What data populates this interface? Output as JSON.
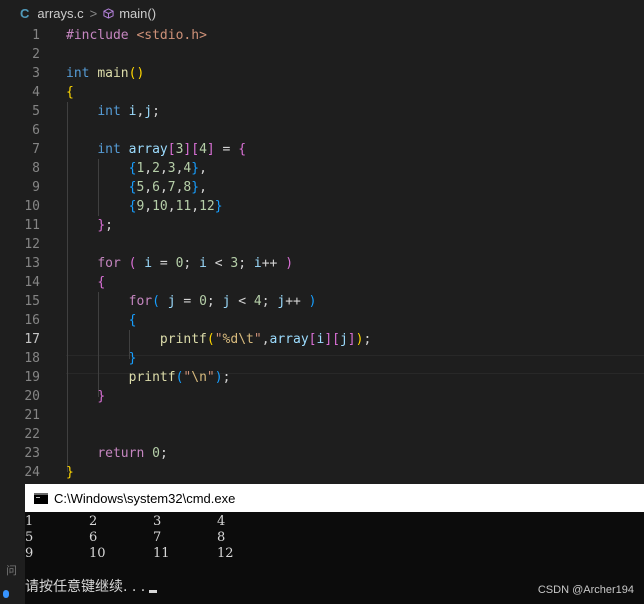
{
  "breadcrumb": {
    "lang_icon": "C",
    "file": "arrays.c",
    "separator": ">",
    "symbol_icon": "cube-icon",
    "function": "main()"
  },
  "editor": {
    "active_line": 17,
    "lines": [
      {
        "n": "1",
        "code": "#include <stdio.h>"
      },
      {
        "n": "2",
        "code": ""
      },
      {
        "n": "3",
        "code": "int main()"
      },
      {
        "n": "4",
        "code": "{"
      },
      {
        "n": "5",
        "code": "    int i,j;"
      },
      {
        "n": "6",
        "code": ""
      },
      {
        "n": "7",
        "code": "    int array[3][4] = {"
      },
      {
        "n": "8",
        "code": "        {1,2,3,4},"
      },
      {
        "n": "9",
        "code": "        {5,6,7,8},"
      },
      {
        "n": "10",
        "code": "        {9,10,11,12}"
      },
      {
        "n": "11",
        "code": "    };"
      },
      {
        "n": "12",
        "code": ""
      },
      {
        "n": "13",
        "code": "    for ( i = 0; i < 3; i++ )"
      },
      {
        "n": "14",
        "code": "    {"
      },
      {
        "n": "15",
        "code": "        for( j = 0; j < 4; j++ )"
      },
      {
        "n": "16",
        "code": "        {"
      },
      {
        "n": "17",
        "code": "            printf(\"%d\\t\",array[i][j]);"
      },
      {
        "n": "18",
        "code": "        }"
      },
      {
        "n": "19",
        "code": "        printf(\"\\n\");"
      },
      {
        "n": "20",
        "code": "    }"
      },
      {
        "n": "21",
        "code": ""
      },
      {
        "n": "22",
        "code": ""
      },
      {
        "n": "23",
        "code": "    return 0;"
      },
      {
        "n": "24",
        "code": "}"
      }
    ]
  },
  "cmd": {
    "title": "C:\\Windows\\system32\\cmd.exe",
    "output": [
      [
        "1",
        "2",
        "3",
        "4"
      ],
      [
        "5",
        "6",
        "7",
        "8"
      ],
      [
        "9",
        "10",
        "11",
        "12"
      ]
    ],
    "prompt": "请按任意键继续. . .",
    "watermark": "CSDN @Archer194"
  },
  "left_strip": {
    "glyph": "问"
  },
  "colors": {
    "editor_bg": "#1e1e1e",
    "keyword": "#c586c0",
    "type": "#569cd6",
    "function": "#dcdcaa",
    "string": "#ce9178",
    "number": "#b5cea8",
    "variable": "#9cdcfe",
    "cmd_bg": "#0c0c0c"
  }
}
